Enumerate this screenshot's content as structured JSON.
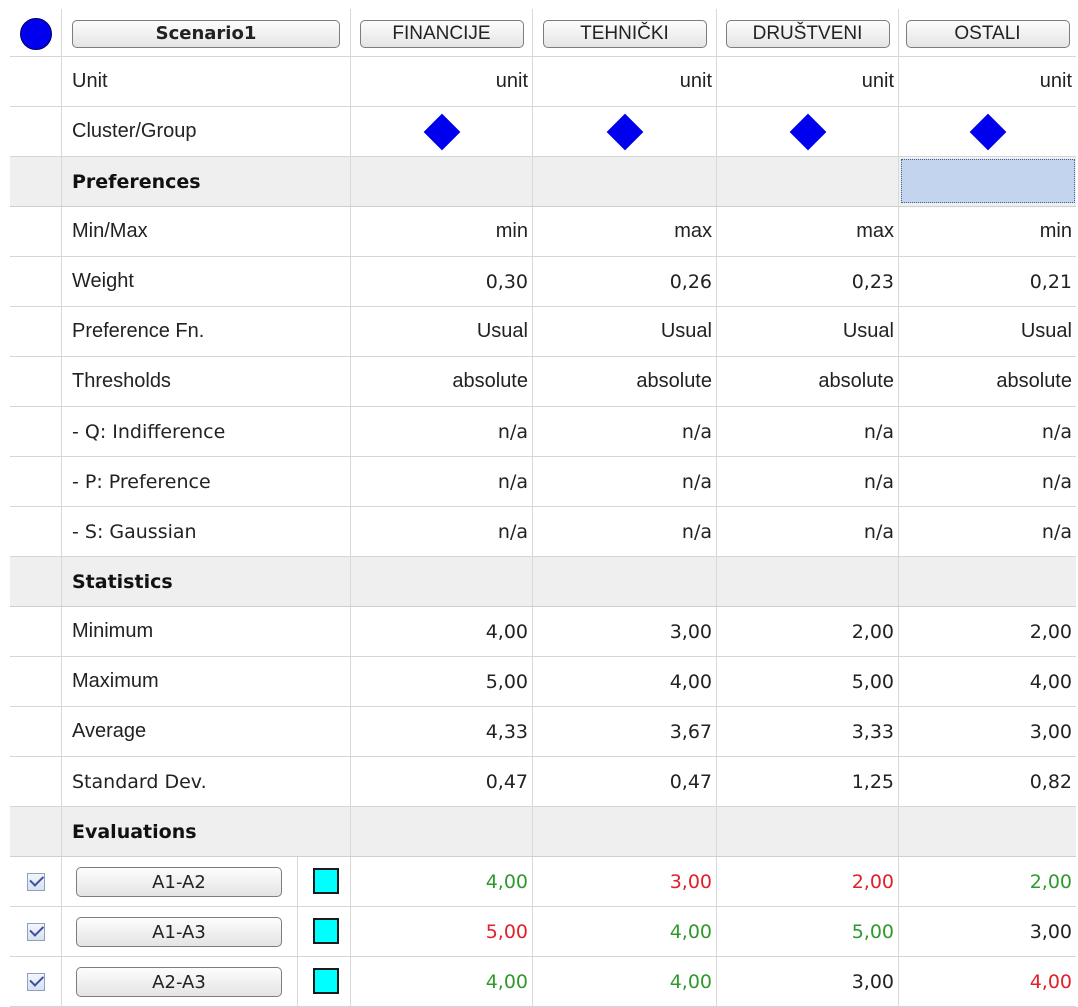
{
  "header": {
    "scenario_label": "Scenario1",
    "criteria": [
      "FINANCIJE",
      "TEHNIČKI",
      "DRUŠTVENI",
      "OSTALI"
    ]
  },
  "unit": {
    "label": "Unit",
    "values": [
      "unit",
      "unit",
      "unit",
      "unit"
    ]
  },
  "cluster": {
    "label": "Cluster/Group"
  },
  "preferences": {
    "title": "Preferences",
    "minmax": {
      "label": "Min/Max",
      "values": [
        "min",
        "max",
        "max",
        "min"
      ]
    },
    "weight": {
      "label": "Weight",
      "values": [
        "0,30",
        "0,26",
        "0,23",
        "0,21"
      ]
    },
    "pref_fn": {
      "label": "Preference Fn.",
      "values": [
        "Usual",
        "Usual",
        "Usual",
        "Usual"
      ]
    },
    "thresholds": {
      "label": "Thresholds",
      "values": [
        "absolute",
        "absolute",
        "absolute",
        "absolute"
      ]
    },
    "q": {
      "label": "- Q: Indifference",
      "values": [
        "n/a",
        "n/a",
        "n/a",
        "n/a"
      ]
    },
    "p": {
      "label": "- P: Preference",
      "values": [
        "n/a",
        "n/a",
        "n/a",
        "n/a"
      ]
    },
    "s": {
      "label": "- S: Gaussian",
      "values": [
        "n/a",
        "n/a",
        "n/a",
        "n/a"
      ]
    }
  },
  "statistics": {
    "title": "Statistics",
    "minimum": {
      "label": "Minimum",
      "values": [
        "4,00",
        "3,00",
        "2,00",
        "2,00"
      ]
    },
    "maximum": {
      "label": "Maximum",
      "values": [
        "5,00",
        "4,00",
        "5,00",
        "4,00"
      ]
    },
    "average": {
      "label": "Average",
      "values": [
        "4,33",
        "3,67",
        "3,33",
        "3,00"
      ]
    },
    "stddev": {
      "label": "Standard Dev.",
      "values": [
        "0,47",
        "0,47",
        "1,25",
        "0,82"
      ]
    }
  },
  "evaluations": {
    "title": "Evaluations",
    "rows": [
      {
        "name": "A1-A2",
        "checked": true,
        "values": [
          "4,00",
          "3,00",
          "2,00",
          "2,00"
        ],
        "colors": [
          "green",
          "red",
          "red",
          "green"
        ]
      },
      {
        "name": "A1-A3",
        "checked": true,
        "values": [
          "5,00",
          "4,00",
          "5,00",
          "3,00"
        ],
        "colors": [
          "red",
          "green",
          "green",
          "dark"
        ]
      },
      {
        "name": "A2-A3",
        "checked": true,
        "values": [
          "4,00",
          "4,00",
          "3,00",
          "4,00"
        ],
        "colors": [
          "green",
          "green",
          "dark",
          "red"
        ]
      }
    ]
  },
  "colors": {
    "scenario_circle": "#0000ee",
    "cluster_diamond": "#0000ee",
    "alternative_swatch": "#00ffff",
    "selected_cell": "#c3d4ee",
    "positive_value": "#2e9a2e",
    "negative_value": "#e0202a"
  },
  "icons": {
    "scenario": "circle-icon",
    "cluster": "diamond-icon",
    "checkbox": "checkbox-checked-icon"
  }
}
